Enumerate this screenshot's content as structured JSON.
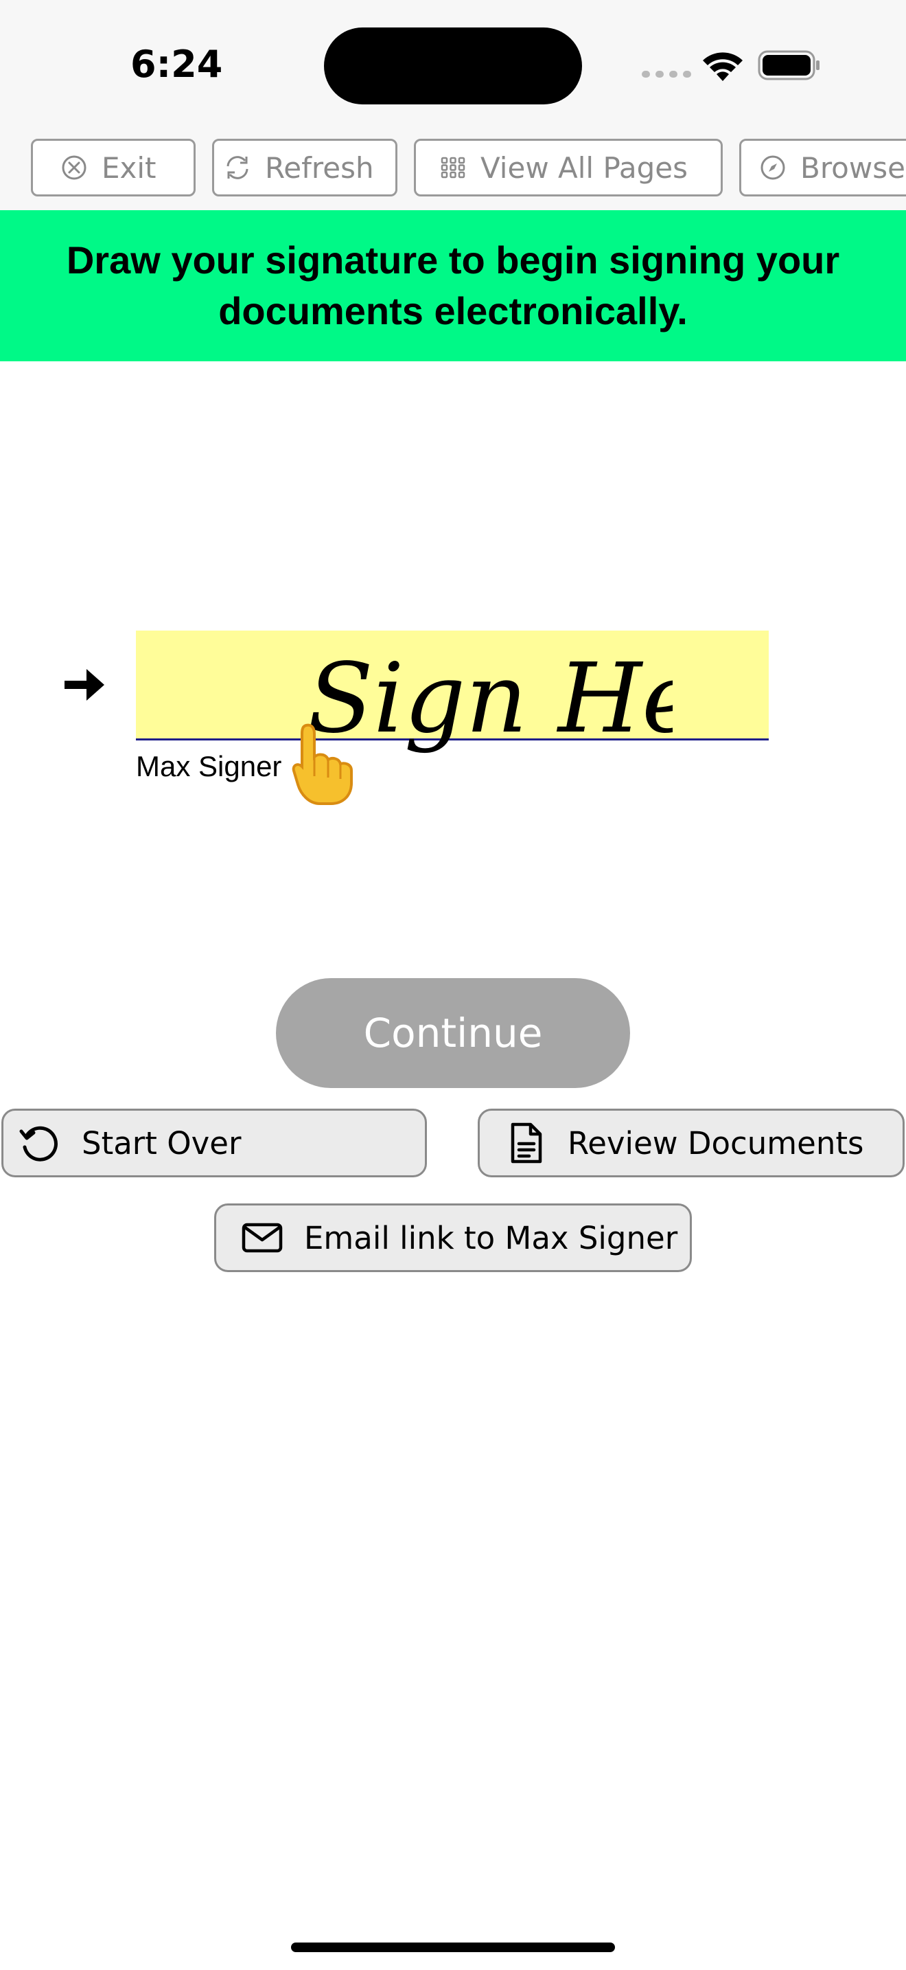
{
  "status_bar": {
    "time": "6:24"
  },
  "toolbar": {
    "buttons": [
      {
        "label": "Exit",
        "icon": "close-circle-icon"
      },
      {
        "label": "Refresh",
        "icon": "refresh-icon"
      },
      {
        "label": "View All Pages",
        "icon": "grid-icon"
      },
      {
        "label": "Browser",
        "icon": "compass-icon"
      }
    ]
  },
  "banner": {
    "text": "Draw your signature to begin signing your documents electronically."
  },
  "signature": {
    "prompt": "Sign Here",
    "signer_name": "Max Signer",
    "field_color": "#fffd99"
  },
  "actions": {
    "continue": "Continue",
    "start_over": "Start Over",
    "review_documents": "Review Documents",
    "email_link": "Email link to Max Signer"
  },
  "colors": {
    "banner": "#00f987",
    "continue_disabled": "#a6a6a6",
    "signature_line": "#1e1e8a"
  }
}
